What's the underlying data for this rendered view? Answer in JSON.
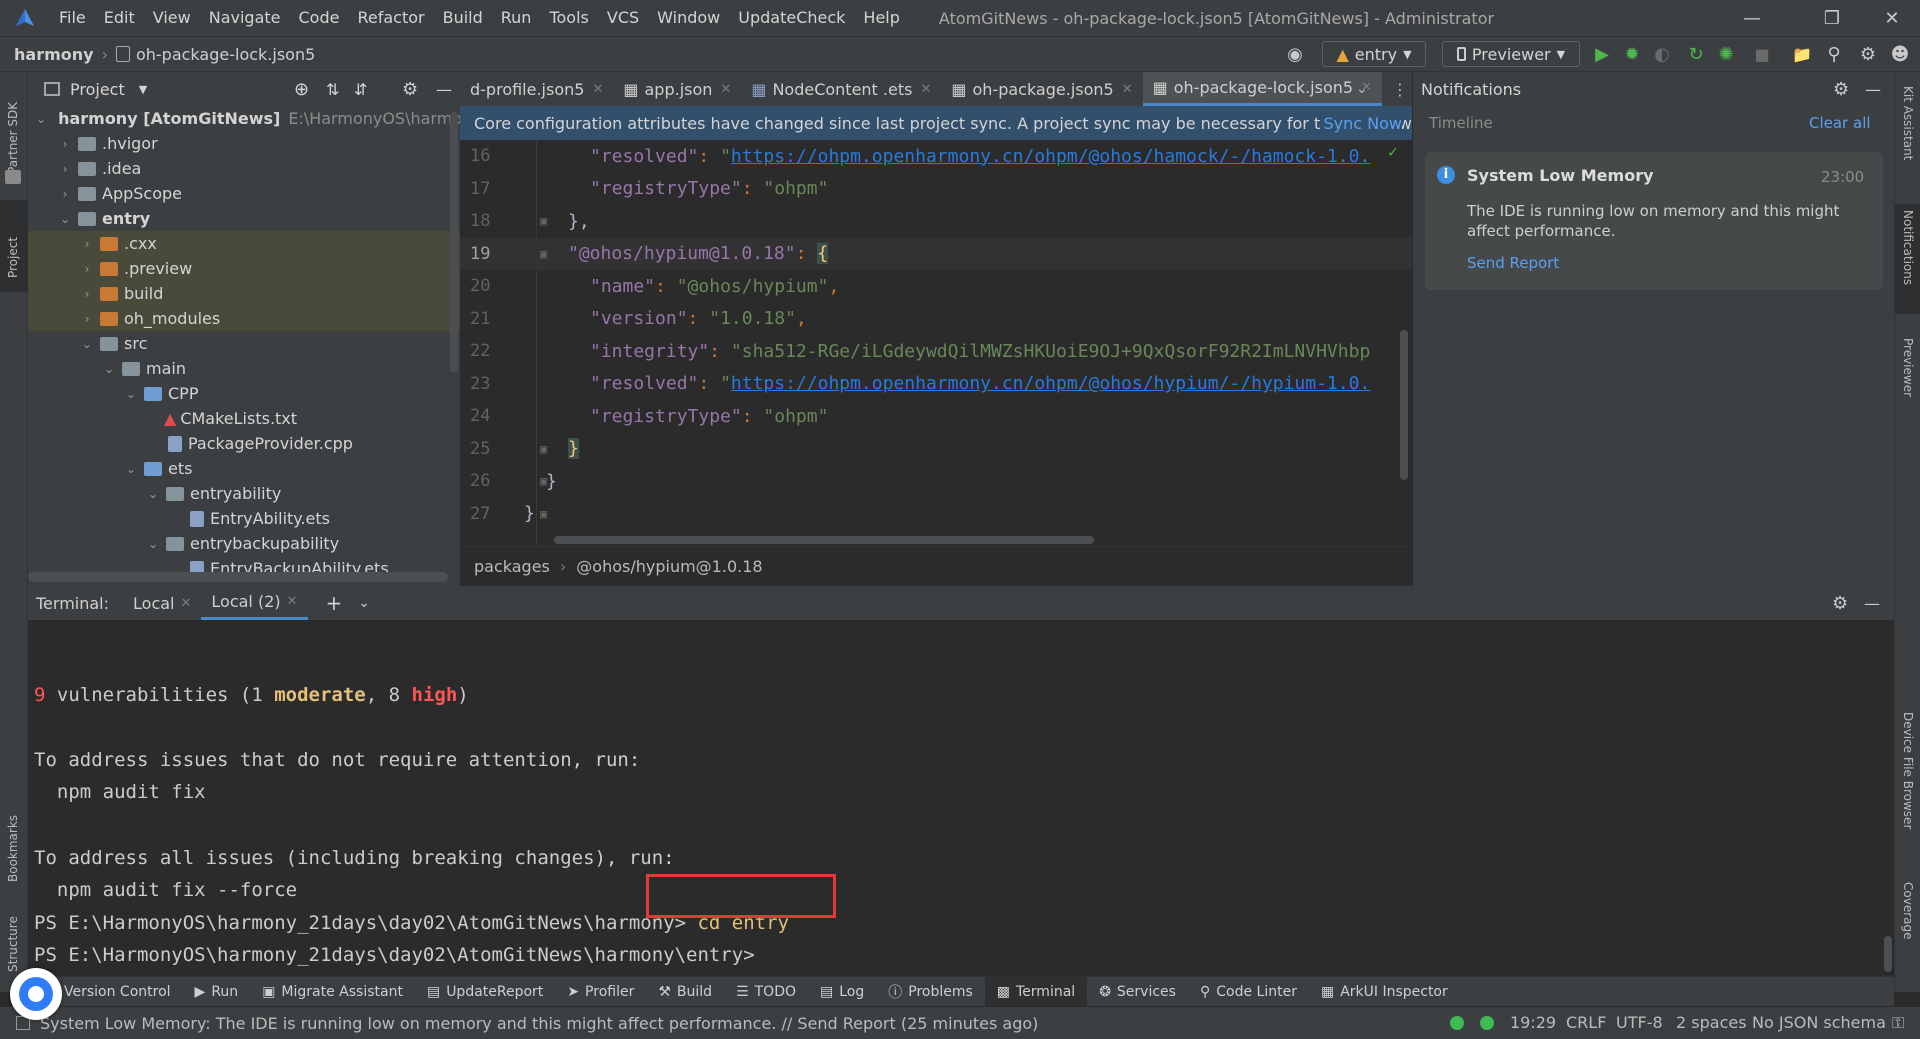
{
  "titlebar": {
    "menu": [
      "File",
      "Edit",
      "View",
      "Navigate",
      "Code",
      "Refactor",
      "Build",
      "Run",
      "Tools",
      "VCS",
      "Window",
      "UpdateCheck",
      "Help"
    ],
    "window_title": "AtomGitNews - oh-package-lock.json5 [AtomGitNews] - Administrator"
  },
  "navbar": {
    "project": "harmony",
    "file": "oh-package-lock.json5",
    "run_config": "entry",
    "device": "Previewer"
  },
  "left_strip": {
    "partner_sdk": "Partner SDK",
    "project": "Project",
    "bookmarks": "Bookmarks",
    "structure": "Structure"
  },
  "right_strip": {
    "kit_assistant": "Kit Assistant",
    "notifications": "Notifications",
    "previewer": "Previewer",
    "device_file_browser": "Device File Browser",
    "coverage": "Coverage"
  },
  "project_panel": {
    "title": "Project",
    "root_name": "harmony [AtomGitNews]",
    "root_path": "E:\\HarmonyOS\\harmony_",
    "items": [
      {
        "label": ".hvigor"
      },
      {
        "label": ".idea"
      },
      {
        "label": "AppScope"
      },
      {
        "label": "entry"
      },
      {
        "label": ".cxx"
      },
      {
        "label": ".preview"
      },
      {
        "label": "build"
      },
      {
        "label": "oh_modules"
      },
      {
        "label": "src"
      },
      {
        "label": "main"
      },
      {
        "label": "CPP"
      },
      {
        "label": "CMakeLists.txt"
      },
      {
        "label": "PackageProvider.cpp"
      },
      {
        "label": "ets"
      },
      {
        "label": "entryability"
      },
      {
        "label": "EntryAbility.ets"
      },
      {
        "label": "entrybackupability"
      },
      {
        "label": "EntryBackupAbility.ets"
      }
    ]
  },
  "editor": {
    "tabs": [
      {
        "label": "d-profile.json5"
      },
      {
        "label": "app.json"
      },
      {
        "label": "NodeContent .ets"
      },
      {
        "label": "oh-package.json5"
      },
      {
        "label": "oh-package-lock.json5"
      }
    ],
    "sync_message": "Core configuration attributes have changed since last project sync. A project sync may be necessary for the IDE to wo",
    "sync_now": "Sync Now",
    "lines": {
      "n16": "16",
      "n17": "17",
      "n18": "18",
      "n19": "19",
      "n20": "20",
      "n21": "21",
      "n22": "22",
      "n23": "23",
      "n24": "24",
      "n25": "25",
      "n26": "26",
      "n27": "27"
    },
    "code": {
      "resolved_key": "\"resolved\"",
      "resolved_url_1": "https://ohpm.openharmony.cn/ohpm/@ohos/hamock/-/hamock-1.0.",
      "registry_key": "\"registryType\"",
      "registry_val": "\"ohpm\"",
      "close_brace_comma": "},",
      "hypium_key": "\"@ohos/hypium@1.0.18\"",
      "name_key": "\"name\"",
      "name_val": "\"@ohos/hypium\"",
      "version_key": "\"version\"",
      "version_val": "\"1.0.18\"",
      "integrity_key": "\"integrity\"",
      "integrity_val": "\"sha512-RGe/iLGdeywdQilMWZsHKUoiE9OJ+9QxQsorF92R2ImLNVHVhbp",
      "resolved_url_2": "https://ohpm.openharmony.cn/ohpm/@ohos/hypium/-/hypium-1.0.",
      "close_brace": "}"
    },
    "breadcrumb": [
      "packages",
      "@ohos/hypium@1.0.18"
    ]
  },
  "notifications": {
    "title": "Notifications",
    "timeline": "Timeline",
    "clear_all": "Clear all",
    "card": {
      "title": "System Low Memory",
      "time": "23:00",
      "body_line1": "The IDE is running low on memory and this might",
      "body_line2": "affect performance.",
      "action": "Send Report"
    }
  },
  "terminal": {
    "label": "Terminal:",
    "tabs": [
      {
        "label": "Local"
      },
      {
        "label": "Local (2)"
      }
    ],
    "vuln_count": "9",
    "vuln_text_a": " vulnerabilities (1 ",
    "vuln_moderate": "moderate",
    "vuln_text_b": ", 8 ",
    "vuln_high": "high",
    "vuln_text_c": ")",
    "line_address1": "To address issues that do not require attention, run:",
    "line_fix": "  npm audit fix",
    "line_address2": "To address all issues (including breaking changes), run:",
    "line_force": "  npm audit fix --force",
    "prompt1": "PS E:\\HarmonyOS\\harmony_21days\\day02\\AtomGitNews\\harmony> ",
    "command": "cd entry",
    "prompt2": "PS E:\\HarmonyOS\\harmony_21days\\day02\\AtomGitNews\\harmony\\entry>"
  },
  "tool_windows": [
    {
      "label": "Version Control"
    },
    {
      "label": "Run"
    },
    {
      "label": "Migrate Assistant"
    },
    {
      "label": "UpdateReport"
    },
    {
      "label": "Profiler"
    },
    {
      "label": "Build"
    },
    {
      "label": "TODO"
    },
    {
      "label": "Log"
    },
    {
      "label": "Problems"
    },
    {
      "label": "Terminal"
    },
    {
      "label": "Services"
    },
    {
      "label": "Code Linter"
    },
    {
      "label": "ArkUI Inspector"
    }
  ],
  "statusbar": {
    "message": "System Low Memory: The IDE is running low on memory and this might affect performance. // Send Report (25 minutes ago)",
    "position": "19:29",
    "line_sep": "CRLF",
    "encoding": "UTF-8",
    "indent": "2 spaces",
    "schema": "No JSON schema"
  },
  "colors": {
    "accent": "#4a88c7",
    "highlight_box": "#e53935",
    "link": "#5aa0f0"
  }
}
